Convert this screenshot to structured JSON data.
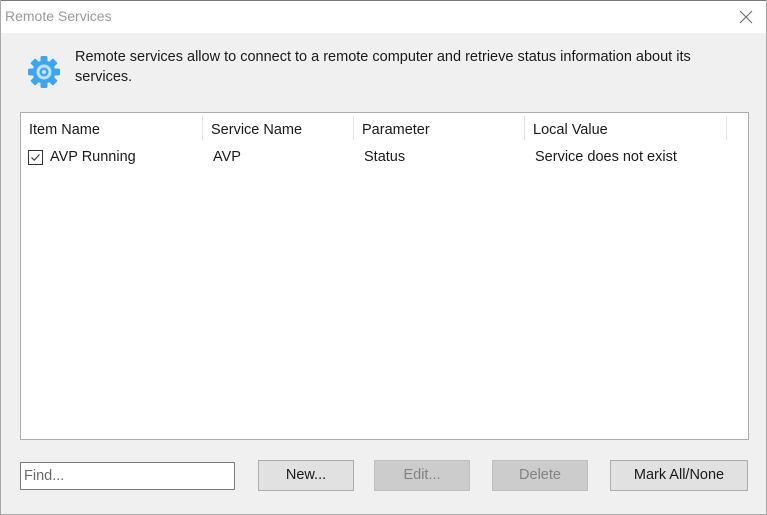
{
  "window": {
    "title": "Remote Services",
    "close_icon": "close-icon"
  },
  "info": {
    "icon": "gear-icon",
    "icon_color": "#3ea6f0",
    "text": "Remote services allow to connect to a remote computer and retrieve status information about its services."
  },
  "table": {
    "columns": [
      {
        "label": "Item Name"
      },
      {
        "label": "Service Name"
      },
      {
        "label": "Parameter"
      },
      {
        "label": "Local Value"
      }
    ],
    "rows": [
      {
        "checked": true,
        "item_name": "AVP Running",
        "service_name": "AVP",
        "parameter": "Status",
        "local_value": "Service does not exist"
      }
    ]
  },
  "footer": {
    "find_placeholder": "Find...",
    "find_value": "",
    "buttons": {
      "new": {
        "label": "New...",
        "enabled": true
      },
      "edit": {
        "label": "Edit...",
        "enabled": false
      },
      "delete": {
        "label": "Delete",
        "enabled": false
      },
      "mark_all": {
        "label": "Mark All/None",
        "enabled": true
      }
    }
  }
}
